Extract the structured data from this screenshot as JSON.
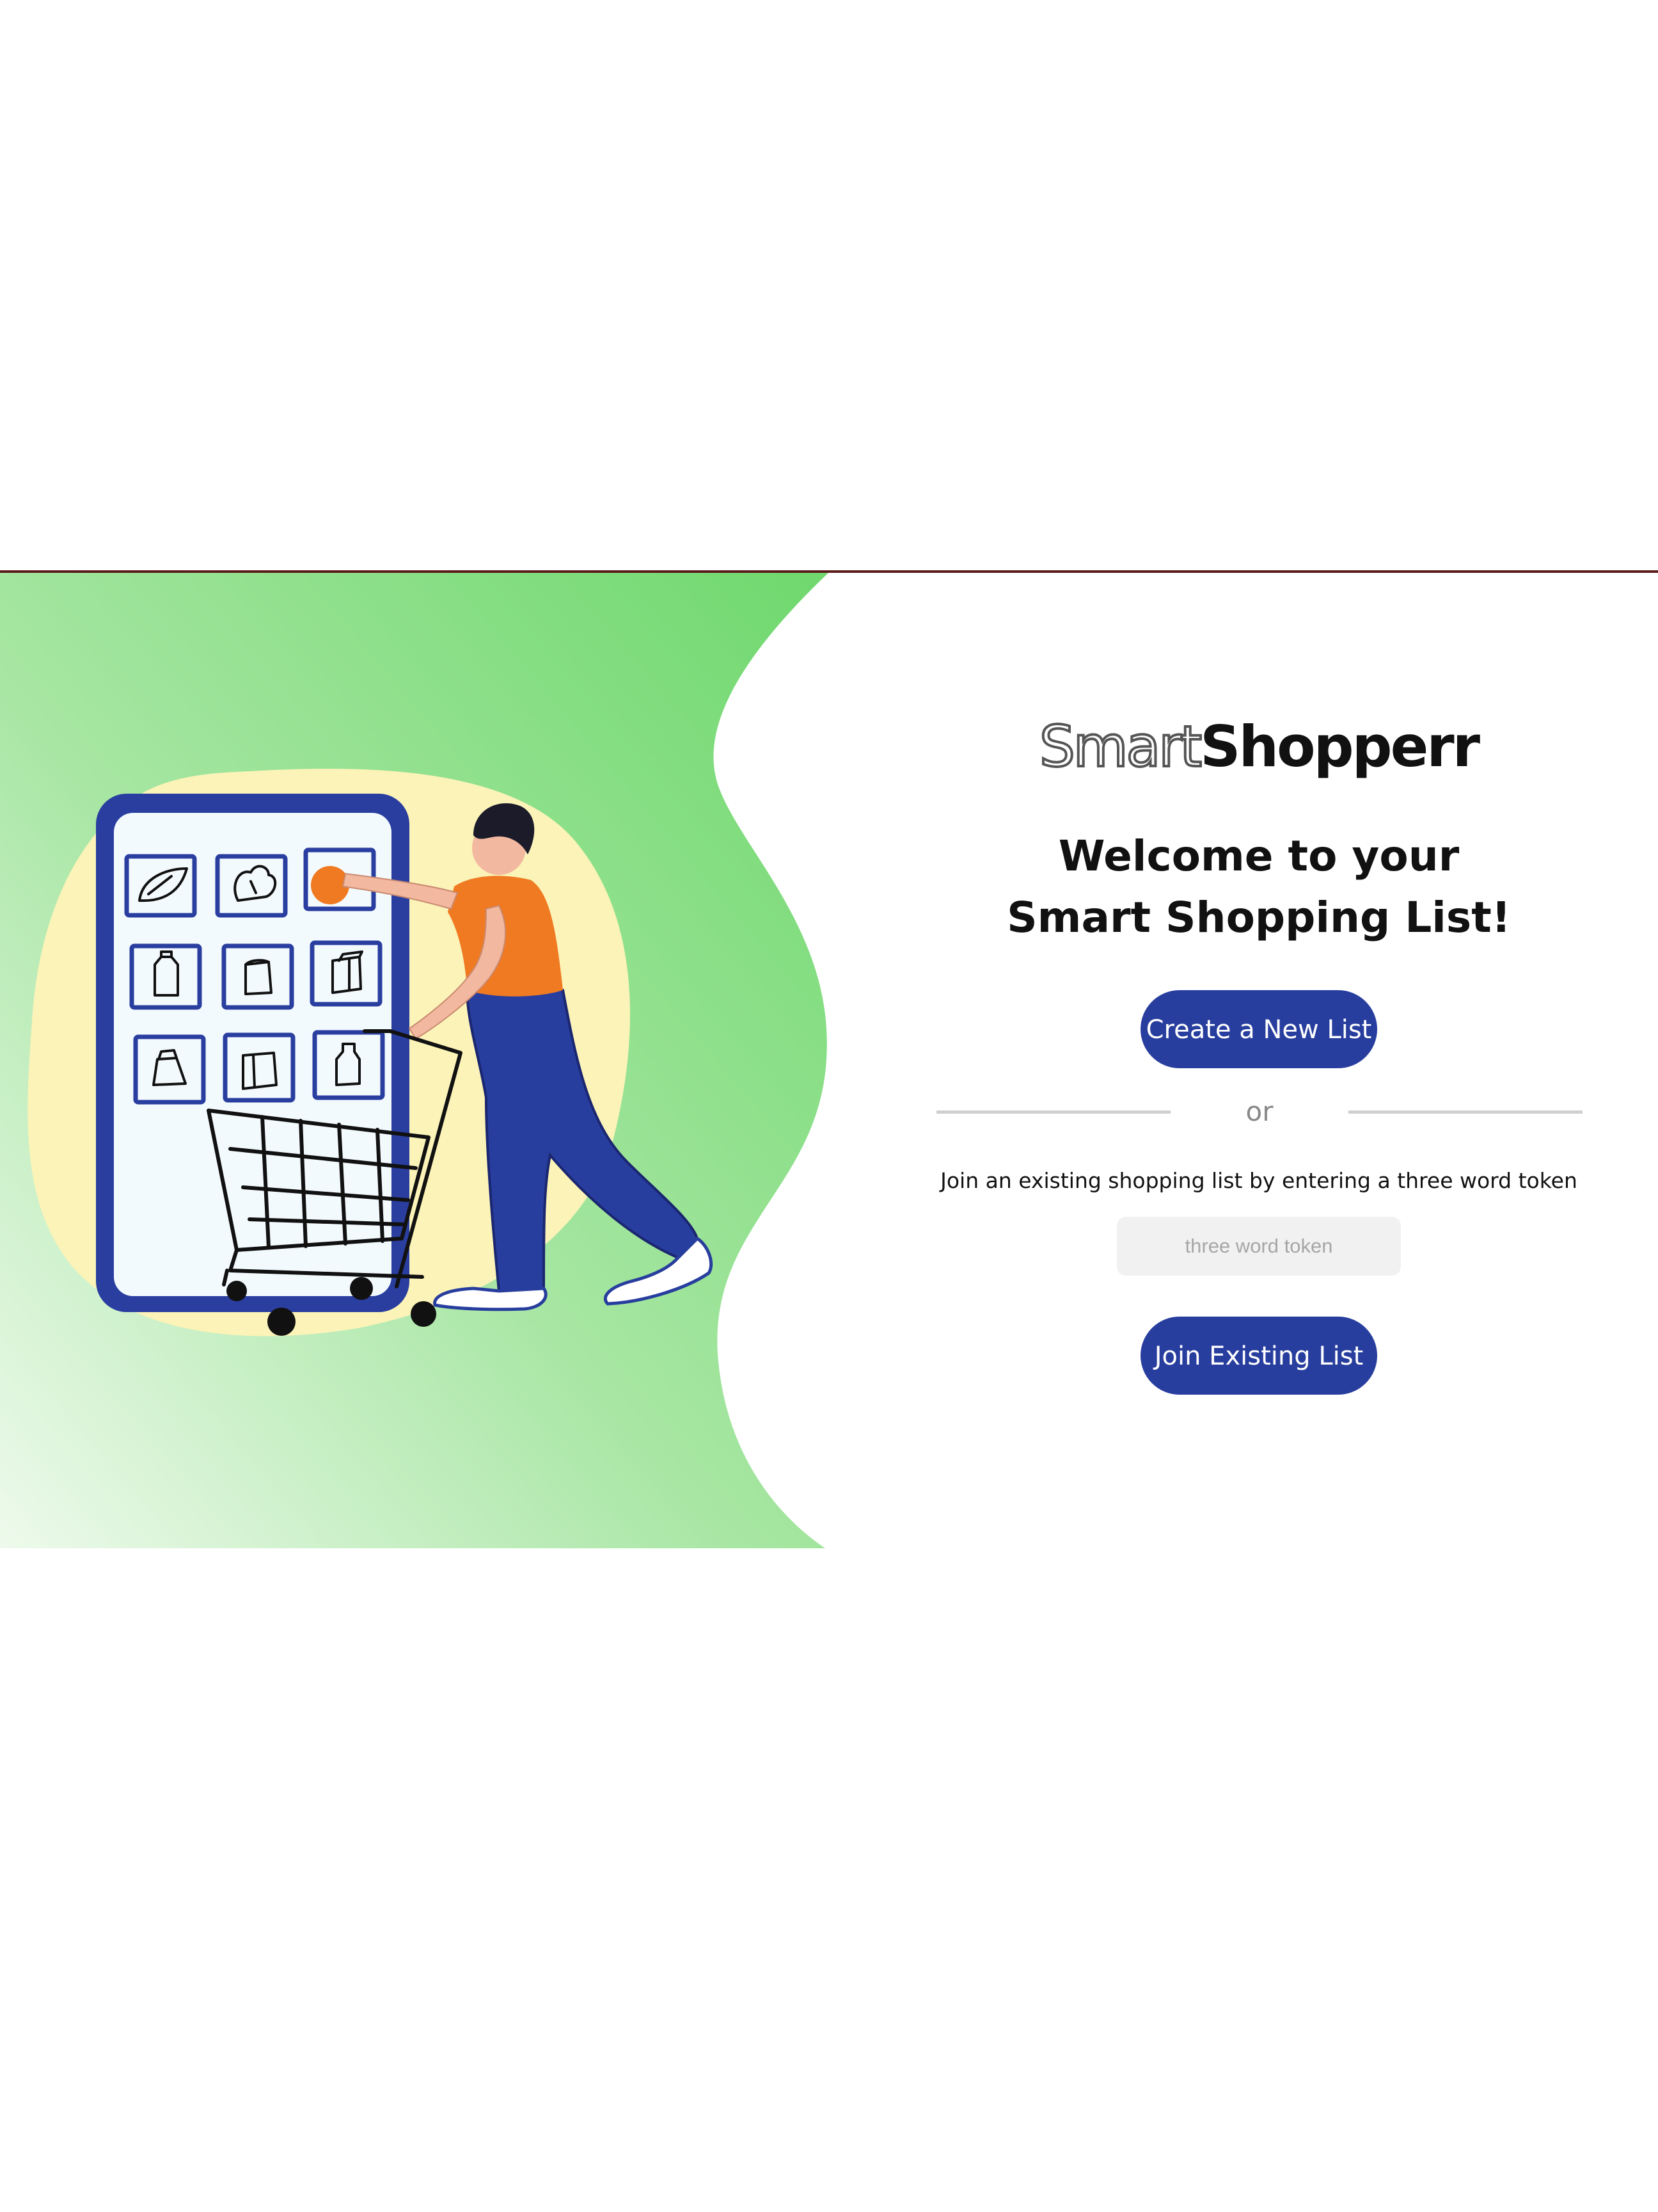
{
  "logo": {
    "light_part": "Smart",
    "dark_part": "Shopperr"
  },
  "welcome": {
    "line1": "Welcome to your",
    "line2": "Smart Shopping List!"
  },
  "actions": {
    "create_label": "Create a New List",
    "or_label": "or",
    "join_instructions": "Join an existing shopping list by entering a three word token",
    "token_placeholder": "three word token",
    "token_value": "",
    "join_label": "Join Existing List"
  },
  "colors": {
    "button": "#283e9e",
    "hero_green": "#7ddc7a",
    "hero_green_light": "#e9f8e6",
    "blob_yellow": "#fbf3b8",
    "phone_blue": "#2a3ea0",
    "shirt_orange": "#f07a22"
  },
  "illustration": {
    "subject": "person-with-shopping-cart-illustration"
  }
}
